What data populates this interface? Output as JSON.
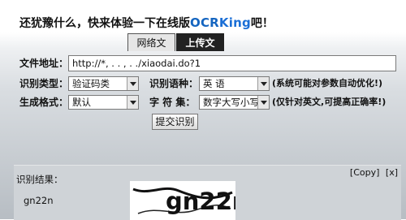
{
  "headline": {
    "prefix": "还犹豫什么，快来体验一下在线版",
    "brand_ocr": "OCR",
    "brand_king": "King",
    "suffix": "吧！"
  },
  "tabs": [
    {
      "label": "网络文件"
    },
    {
      "label": "上传文件"
    }
  ],
  "form": {
    "url_label": "文件地址：",
    "url_value": "http://*, .  .   ,    .   ./xiaodai.do?1",
    "type_label": "识别类型：",
    "type_value": "验证码类",
    "lang_label": "识别语种：",
    "lang_value": "英 语",
    "lang_note": "(系统可能对参数自动优化!)",
    "format_label": "生成格式：",
    "format_value": "默认",
    "charset_label": "字 符 集：",
    "charset_value": "数字大写小写",
    "charset_note": "(仅针对英文,可提高正确率!)",
    "submit_label": "提交识别"
  },
  "result": {
    "label": "识别结果：",
    "copy_label": "[Copy]",
    "close_label": "[x]",
    "text": "gn22n",
    "captcha_text": "gn22n"
  },
  "colors": {
    "brand": "#1565c0",
    "tab_active_bg": "#222222"
  }
}
